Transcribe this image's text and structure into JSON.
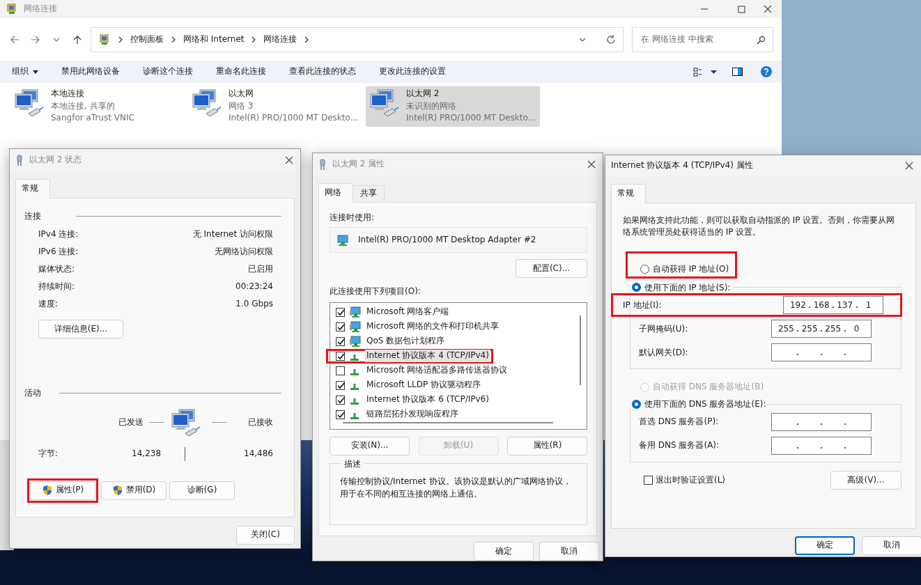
{
  "explorer": {
    "title": "网络连接",
    "breadcrumb": [
      "控制面板",
      "网络和 Internet",
      "网络连接"
    ],
    "search": {
      "placeholder": "在 网络连接 中搜索"
    },
    "commands": [
      {
        "label": "组织",
        "kind": "menu"
      },
      {
        "label": "禁用此网络设备",
        "kind": "plain"
      },
      {
        "label": "诊断这个连接",
        "kind": "plain"
      },
      {
        "label": "重命名此连接",
        "kind": "plain"
      },
      {
        "label": "查看此连接的状态",
        "kind": "plain"
      },
      {
        "label": "更改此连接的设置",
        "kind": "plain"
      }
    ],
    "connections": [
      {
        "name": "本地连接",
        "status": "本地连接, 共享的",
        "adapter": "Sangfor aTrust VNIC",
        "selected": false
      },
      {
        "name": "以太网",
        "status": "网络 3",
        "adapter": "Intel(R) PRO/1000 MT Deskto...",
        "selected": false
      },
      {
        "name": "以太网 2",
        "status": "未识别的网络",
        "adapter": "Intel(R) PRO/1000 MT Deskto...",
        "selected": true
      }
    ]
  },
  "status_dialog": {
    "title": "以太网 2 状态",
    "tabs": [
      {
        "label": "常规",
        "selected": true
      }
    ],
    "connection_heading": "连接",
    "rows": [
      {
        "label": "IPv4 连接:",
        "value": "无 Internet 访问权限"
      },
      {
        "label": "IPv6 连接:",
        "value": "无网络访问权限"
      },
      {
        "label": "媒体状态:",
        "value": "已启用"
      },
      {
        "label": "持续时间:",
        "value": "00:23:24"
      },
      {
        "label": "速度:",
        "value": "1.0 Gbps"
      }
    ],
    "details_button": "详细信息(E)...",
    "activity_heading": "活动",
    "sent_label": "已发送",
    "received_label": "已接收",
    "bytes_label": "字节:",
    "bytes_sent": "14,238",
    "bytes_received": "14,486",
    "buttons": [
      {
        "label": "属性(P)",
        "shield": true,
        "highlighted": true
      },
      {
        "label": "禁用(D)",
        "shield": true,
        "highlighted": false
      },
      {
        "label": "诊断(G)",
        "shield": false,
        "highlighted": false
      }
    ],
    "close_button": "关闭(C)"
  },
  "properties_dialog": {
    "title": "以太网 2 属性",
    "tabs": [
      {
        "label": "网络",
        "selected": true
      },
      {
        "label": "共享",
        "selected": false
      }
    ],
    "connect_using_label": "连接时使用:",
    "adapter": "Intel(R) PRO/1000 MT Desktop Adapter #2",
    "configure_button": "配置(C)...",
    "items_label": "此连接使用下列项目(O):",
    "items": [
      {
        "label": "Microsoft 网络客户端",
        "kind": "client",
        "checked": true,
        "selected": false,
        "highlighted": false
      },
      {
        "label": "Microsoft 网络的文件和打印机共享",
        "kind": "client",
        "checked": true,
        "selected": false,
        "highlighted": false
      },
      {
        "label": "QoS 数据包计划程序",
        "kind": "client",
        "checked": true,
        "selected": false,
        "highlighted": false
      },
      {
        "label": "Internet 协议版本 4 (TCP/IPv4)",
        "kind": "protocol",
        "checked": true,
        "selected": true,
        "highlighted": true
      },
      {
        "label": "Microsoft 网络适配器多路传送器协议",
        "kind": "protocol",
        "checked": false,
        "selected": false,
        "highlighted": false
      },
      {
        "label": "Microsoft LLDP 协议驱动程序",
        "kind": "protocol",
        "checked": true,
        "selected": false,
        "highlighted": false
      },
      {
        "label": "Internet 协议版本 6 (TCP/IPv6)",
        "kind": "protocol",
        "checked": true,
        "selected": false,
        "highlighted": false
      },
      {
        "label": "链路层拓扑发现响应程序",
        "kind": "protocol",
        "checked": true,
        "selected": false,
        "highlighted": false
      }
    ],
    "buttons": [
      {
        "label": "安装(N)...",
        "disabled": false
      },
      {
        "label": "卸载(U)",
        "disabled": true
      },
      {
        "label": "属性(R)",
        "disabled": false
      }
    ],
    "description_heading": "描述",
    "description": "传输控制协议/Internet 协议。该协议是默认的广域网络协议，用于在不同的相互连接的网络上通信。",
    "ok_button": "确定",
    "cancel_button": "取消"
  },
  "ipv4_dialog": {
    "title": "Internet 协议版本 4 (TCP/IPv4) 属性",
    "tabs": [
      {
        "label": "常规",
        "selected": true
      }
    ],
    "intro": "如果网络支持此功能，则可以获取自动指派的 IP 设置。否则，你需要从网络系统管理员处获得适当的 IP 设置。",
    "ip_auto": {
      "label": "自动获得 IP 地址(O)",
      "selected": false,
      "disabled": false,
      "highlighted": true
    },
    "ip_manual": {
      "label": "使用下面的 IP 地址(S):",
      "selected": true,
      "disabled": false
    },
    "ip_fields": [
      {
        "label": "IP 地址(I):",
        "octets": [
          "192",
          "168",
          "137",
          "1"
        ],
        "highlighted": true
      },
      {
        "label": "子网掩码(U):",
        "octets": [
          "255",
          "255",
          "255",
          "0"
        ],
        "highlighted": false
      },
      {
        "label": "默认网关(D):",
        "highlighted": false
      }
    ],
    "dns_auto": {
      "label": "自动获得 DNS 服务器地址(B)",
      "selected": false,
      "disabled": true
    },
    "dns_manual": {
      "label": "使用下面的 DNS 服务器地址(E):",
      "selected": true,
      "disabled": false
    },
    "dns_fields": [
      {
        "label": "首选 DNS 服务器(P):",
        "highlighted": false
      },
      {
        "label": "备用 DNS 服务器(A):",
        "highlighted": false
      }
    ],
    "validate": {
      "label": "退出时验证设置(L)",
      "checked": false
    },
    "advanced_button": "高级(V)...",
    "ok_button": "确定",
    "cancel_button": "取消"
  }
}
